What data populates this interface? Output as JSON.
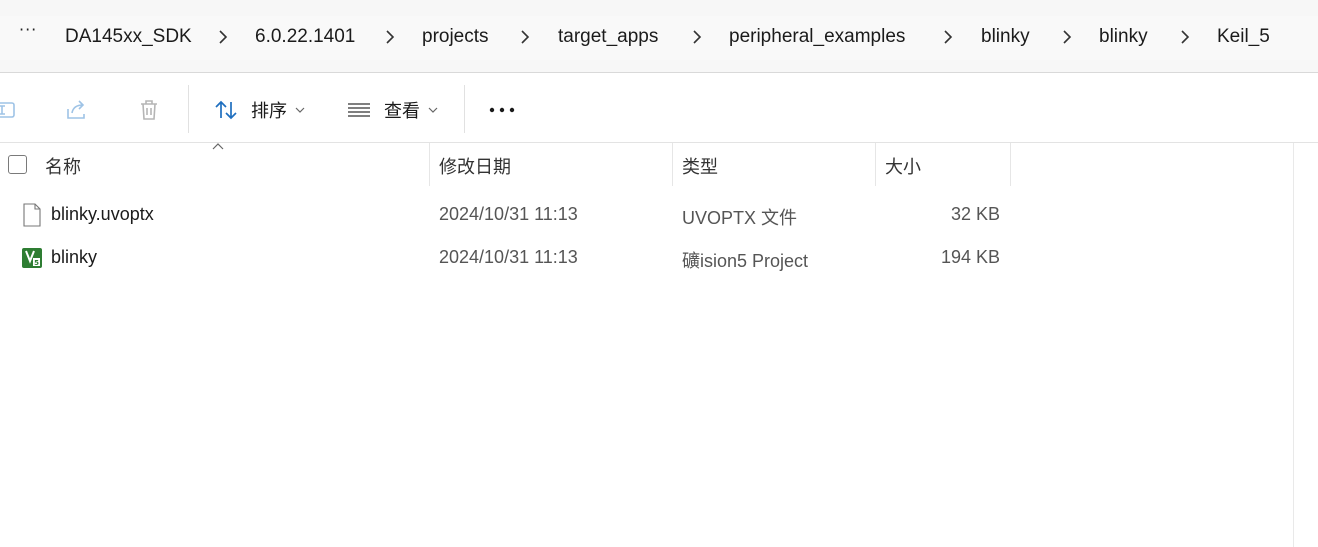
{
  "breadcrumb": {
    "overflow": "···",
    "items": [
      "DA145xx_SDK",
      "6.0.22.1401",
      "projects",
      "target_apps",
      "peripheral_examples",
      "blinky",
      "blinky",
      "Keil_5"
    ]
  },
  "toolbar": {
    "sort_label": "排序",
    "view_label": "查看",
    "more_label": "•••",
    "icons": [
      "rename-icon",
      "share-icon",
      "delete-icon",
      "sort-icon",
      "view-icon",
      "more-icon"
    ]
  },
  "columns": {
    "name": "名称",
    "date": "修改日期",
    "type": "类型",
    "size": "大小"
  },
  "files": [
    {
      "name": "blinky.uvoptx",
      "date": "2024/10/31 11:13",
      "type": "UVOPTX 文件",
      "size": "32 KB",
      "icon": "generic-file-icon"
    },
    {
      "name": "blinky",
      "date": "2024/10/31 11:13",
      "type": "礦ision5 Project",
      "size": "194 KB",
      "icon": "uvision-project-icon"
    }
  ],
  "colors": {
    "accent": "#1f6fbf",
    "uvision_green": "#2e7d32",
    "breadcrumb_bg": "#f9f9f9"
  }
}
